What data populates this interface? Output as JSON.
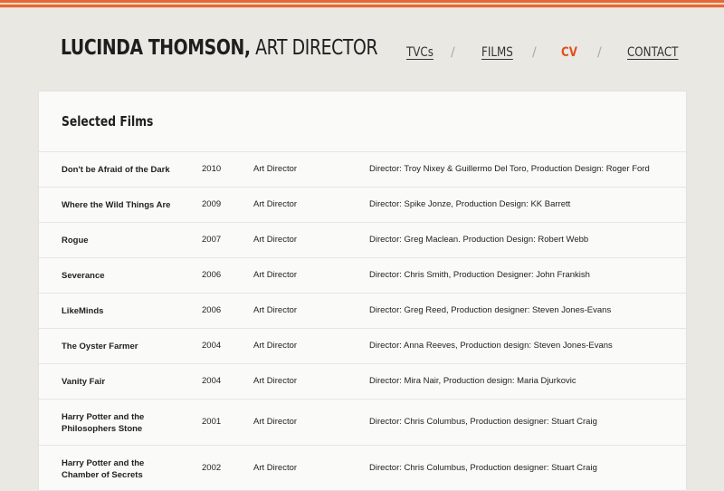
{
  "header": {
    "name": "LUCINDA THOMSON,",
    "role": " ART DIRECTOR"
  },
  "nav": [
    {
      "label": "TVCs",
      "active": false
    },
    {
      "label": "FILMS",
      "active": false
    },
    {
      "label": "CV",
      "active": true
    },
    {
      "label": "CONTACT",
      "active": false
    }
  ],
  "nav_separator": "/",
  "section": {
    "title": "Selected Films"
  },
  "films": [
    {
      "title": "Don't be Afraid of the Dark",
      "year": "2010",
      "role": "Art Director",
      "credits": "Director: Troy Nixey & Guillermo Del Toro, Production Design: Roger Ford"
    },
    {
      "title": "Where the Wild Things Are",
      "year": "2009",
      "role": "Art Director",
      "credits": "Director: Spike Jonze, Production Design: KK Barrett"
    },
    {
      "title": "Rogue",
      "year": "2007",
      "role": "Art Director",
      "credits": "Director: Greg Maclean. Production Design: Robert Webb"
    },
    {
      "title": "Severance",
      "year": "2006",
      "role": "Art Director",
      "credits": "Director: Chris Smith, Production Designer: John Frankish"
    },
    {
      "title": "LikeMinds",
      "year": "2006",
      "role": "Art Director",
      "credits": "Director: Greg Reed, Production designer: Steven Jones-Evans"
    },
    {
      "title": "The Oyster Farmer",
      "year": "2004",
      "role": "Art Director",
      "credits": "Director: Anna Reeves, Production design: Steven Jones-Evans"
    },
    {
      "title": "Vanity Fair",
      "year": "2004",
      "role": "Art Director",
      "credits": "Director: Mira Nair, Production design: Maria Djurkovic"
    },
    {
      "title": "Harry Potter and the Philosophers Stone",
      "year": "2001",
      "role": "Art Director",
      "credits": "Director: Chris Columbus, Production designer: Stuart Craig"
    },
    {
      "title": "Harry Potter and the Chamber of Secrets",
      "year": "2002",
      "role": "Art Director",
      "credits": "Director: Chris Columbus, Production designer: Stuart Craig"
    }
  ],
  "colors": {
    "accent": "#e0501f",
    "stripe": "#e4673a",
    "background": "#eae8e3",
    "panel": "#fafaf9"
  }
}
